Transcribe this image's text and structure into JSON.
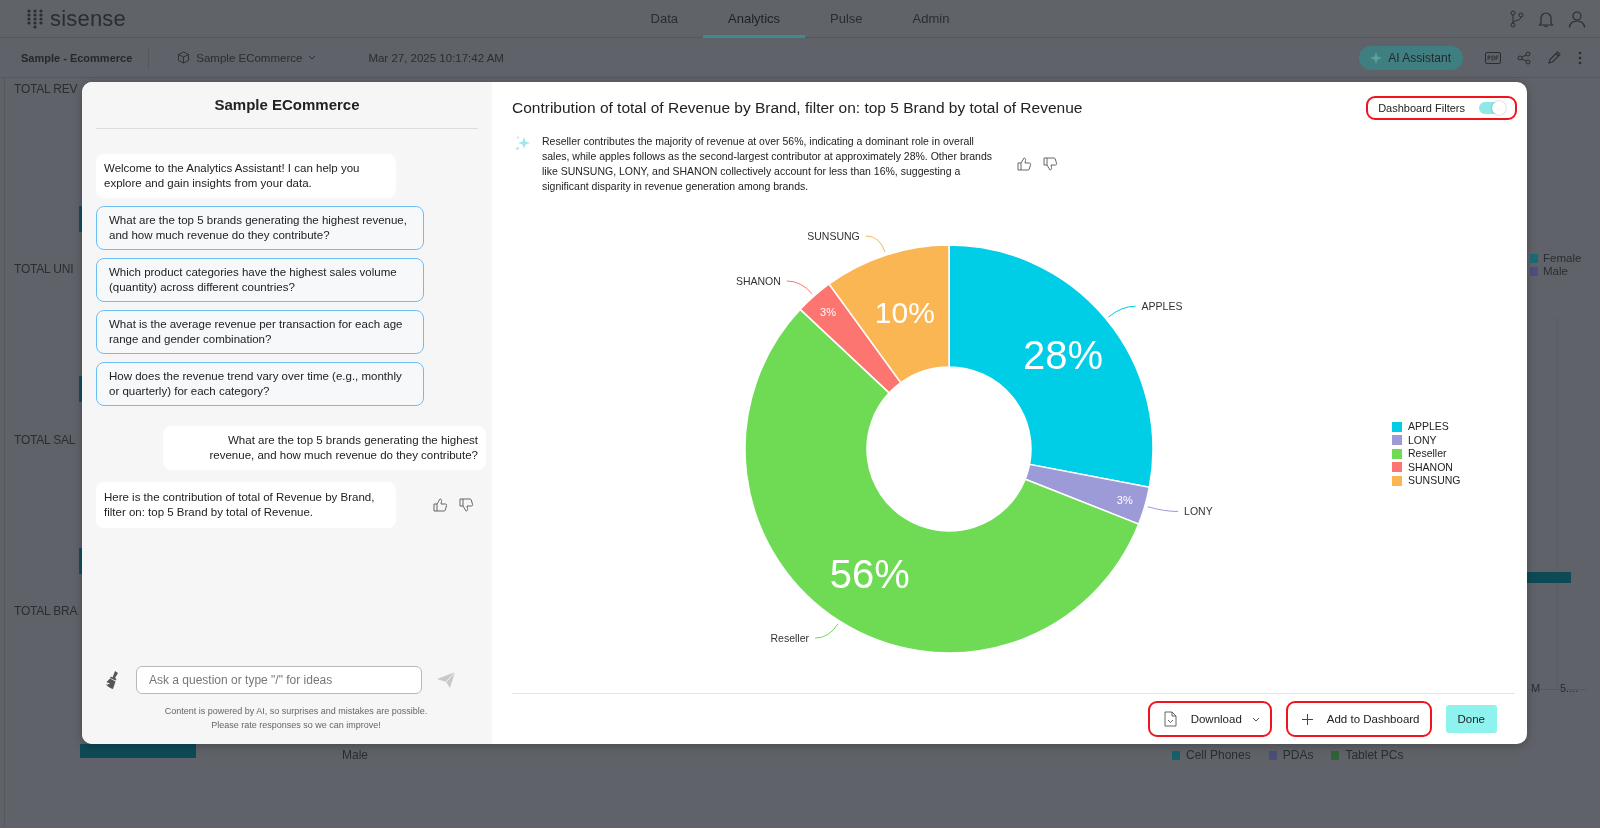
{
  "app_bar": {
    "logo": "sisense",
    "nav_tabs": [
      {
        "label": "Data",
        "selected": false
      },
      {
        "label": "Analytics",
        "selected": true
      },
      {
        "label": "Pulse",
        "selected": false
      },
      {
        "label": "Admin",
        "selected": false
      }
    ]
  },
  "dashboard_bar": {
    "title": "Sample - Ecommerce",
    "data_source": "Sample ECommerce",
    "updated": "Mar 27, 2025 10:17:42 AM",
    "assistant_button": "AI Assistant"
  },
  "background_widgets": {
    "titles": [
      "TOTAL REV",
      "TOTAL UNI",
      "TOTAL SAL",
      "TOTAL BRA"
    ],
    "gender_legend": [
      {
        "label": "Female",
        "color": "#1d6a74"
      },
      {
        "label": "Male",
        "color": "#4b4f82"
      }
    ],
    "category_legend": [
      {
        "label": "Cell Phones",
        "color": "#17606a"
      },
      {
        "label": "PDAs",
        "color": "#4a4e78"
      },
      {
        "label": "Tablet PCs",
        "color": "#2e6438"
      }
    ],
    "axis_labels": [
      "M",
      "5...."
    ],
    "pie_label": "Male"
  },
  "chat": {
    "title": "Sample ECommerce",
    "messages": [
      {
        "kind": "assistant",
        "text": "Welcome to the Analytics Assistant! I can help you explore and gain insights from your data."
      },
      {
        "kind": "suggestion",
        "text": "What are the top 5 brands generating the highest revenue, and how much revenue do they contribute?"
      },
      {
        "kind": "suggestion",
        "text": "Which product categories have the highest sales volume (quantity) across different countries?"
      },
      {
        "kind": "suggestion",
        "text": "What is the average revenue per transaction for each age range and gender combination?"
      },
      {
        "kind": "suggestion",
        "text": "How does the revenue trend vary over time (e.g., monthly or quarterly) for each category?"
      },
      {
        "kind": "user",
        "text": "What are the top 5 brands generating the highest revenue, and how much revenue do they contribute?"
      },
      {
        "kind": "answer",
        "text": "Here is the contribution of total of Revenue by Brand, filter on: top 5 Brand by total of Revenue."
      }
    ],
    "input": {
      "placeholder": "Ask a question or type \"/\" for ideas"
    },
    "disclaimer": [
      "Content is powered by AI, so surprises and mistakes are possible.",
      "Please rate responses so we can improve!"
    ]
  },
  "result": {
    "title": "Contribution of total of Revenue by Brand, filter on: top 5 Brand by total of Revenue",
    "dashboard_filters": {
      "label": "Dashboard Filters",
      "on": true,
      "highlighted": true
    },
    "insight": "Reseller contributes the majority of revenue at over 56%, indicating a dominant role in overall sales, while apples follows as the second-largest contributor at approximately 28%. Other brands like SUNSUNG, LONY, and SHANON collectively account for less than 16%, suggesting a significant disparity in revenue generation among brands.",
    "chart_data": {
      "type": "donut",
      "categories": [
        "APPLES",
        "LONY",
        "Reseller",
        "SHANON",
        "SUNSUNG"
      ],
      "values": [
        28,
        3,
        56,
        3,
        10
      ],
      "value_labels": [
        "28%",
        "3%",
        "56%",
        "3%",
        "10%"
      ]
    },
    "legend": [
      {
        "label": "APPLES",
        "color": "#00cde6"
      },
      {
        "label": "LONY",
        "color": "#9d9ad8"
      },
      {
        "label": "Reseller",
        "color": "#6fdb55"
      },
      {
        "label": "SHANON",
        "color": "#fc7570"
      },
      {
        "label": "SUNSUNG",
        "color": "#fbb654"
      }
    ],
    "buttons": [
      {
        "kind": "download",
        "label": "Download",
        "highlighted": true
      },
      {
        "kind": "add",
        "label": "Add to Dashboard",
        "highlighted": true
      },
      {
        "kind": "done",
        "label": "Done",
        "highlighted": false
      }
    ]
  }
}
